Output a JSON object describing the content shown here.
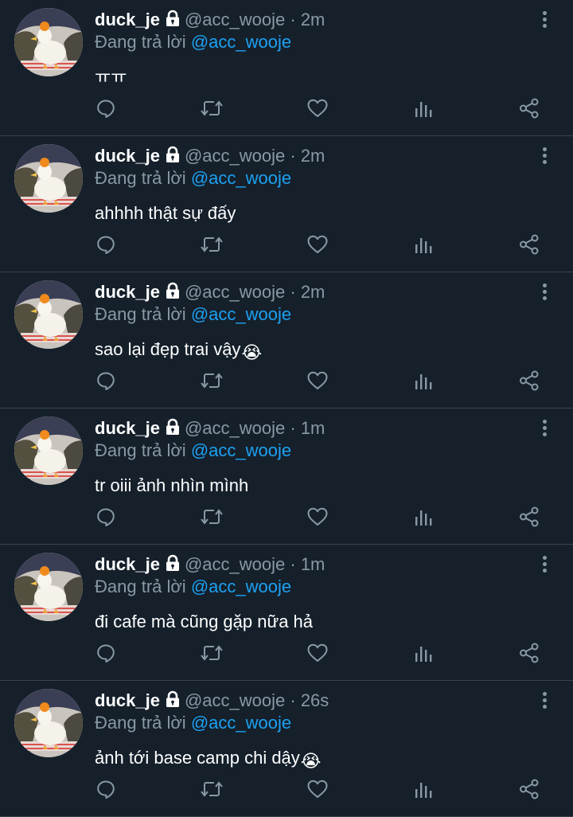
{
  "colors": {
    "background": "#15202b",
    "divider": "#38444d",
    "secondary_text": "#8899a6",
    "mention": "#1da1f2",
    "primary_text": "#ffffff"
  },
  "icons": {
    "more": "more-vertical-icon",
    "reply": "reply-icon",
    "retweet": "retweet-icon",
    "like": "heart-icon",
    "analytics": "analytics-icon",
    "share": "share-icon",
    "lock": "lock-icon"
  },
  "tweets": [
    {
      "name": "duck_je",
      "handle": "@acc_wooje",
      "dot": "·",
      "time": "2m",
      "reply_prefix": "Đang trả lời",
      "reply_to": "@acc_wooje",
      "text": "ㅠㅠ",
      "emoji": ""
    },
    {
      "name": "duck_je",
      "handle": "@acc_wooje",
      "dot": "·",
      "time": "2m",
      "reply_prefix": "Đang trả lời",
      "reply_to": "@acc_wooje",
      "text": "ahhhh thật sự đấy",
      "emoji": ""
    },
    {
      "name": "duck_je",
      "handle": "@acc_wooje",
      "dot": "·",
      "time": "2m",
      "reply_prefix": "Đang trả lời",
      "reply_to": "@acc_wooje",
      "text": "sao lại đẹp trai vậy",
      "emoji": "😭"
    },
    {
      "name": "duck_je",
      "handle": "@acc_wooje",
      "dot": "·",
      "time": "1m",
      "reply_prefix": "Đang trả lời",
      "reply_to": "@acc_wooje",
      "text": "tr oiii ảnh nhìn mình",
      "emoji": ""
    },
    {
      "name": "duck_je",
      "handle": "@acc_wooje",
      "dot": "·",
      "time": "1m",
      "reply_prefix": "Đang trả lời",
      "reply_to": "@acc_wooje",
      "text": "đi cafe mà cũng gặp nữa hả",
      "emoji": ""
    },
    {
      "name": "duck_je",
      "handle": "@acc_wooje",
      "dot": "·",
      "time": "26s",
      "reply_prefix": "Đang trả lời",
      "reply_to": "@acc_wooje",
      "text": "ảnh tới base camp chi dậy",
      "emoji": "😭"
    }
  ]
}
